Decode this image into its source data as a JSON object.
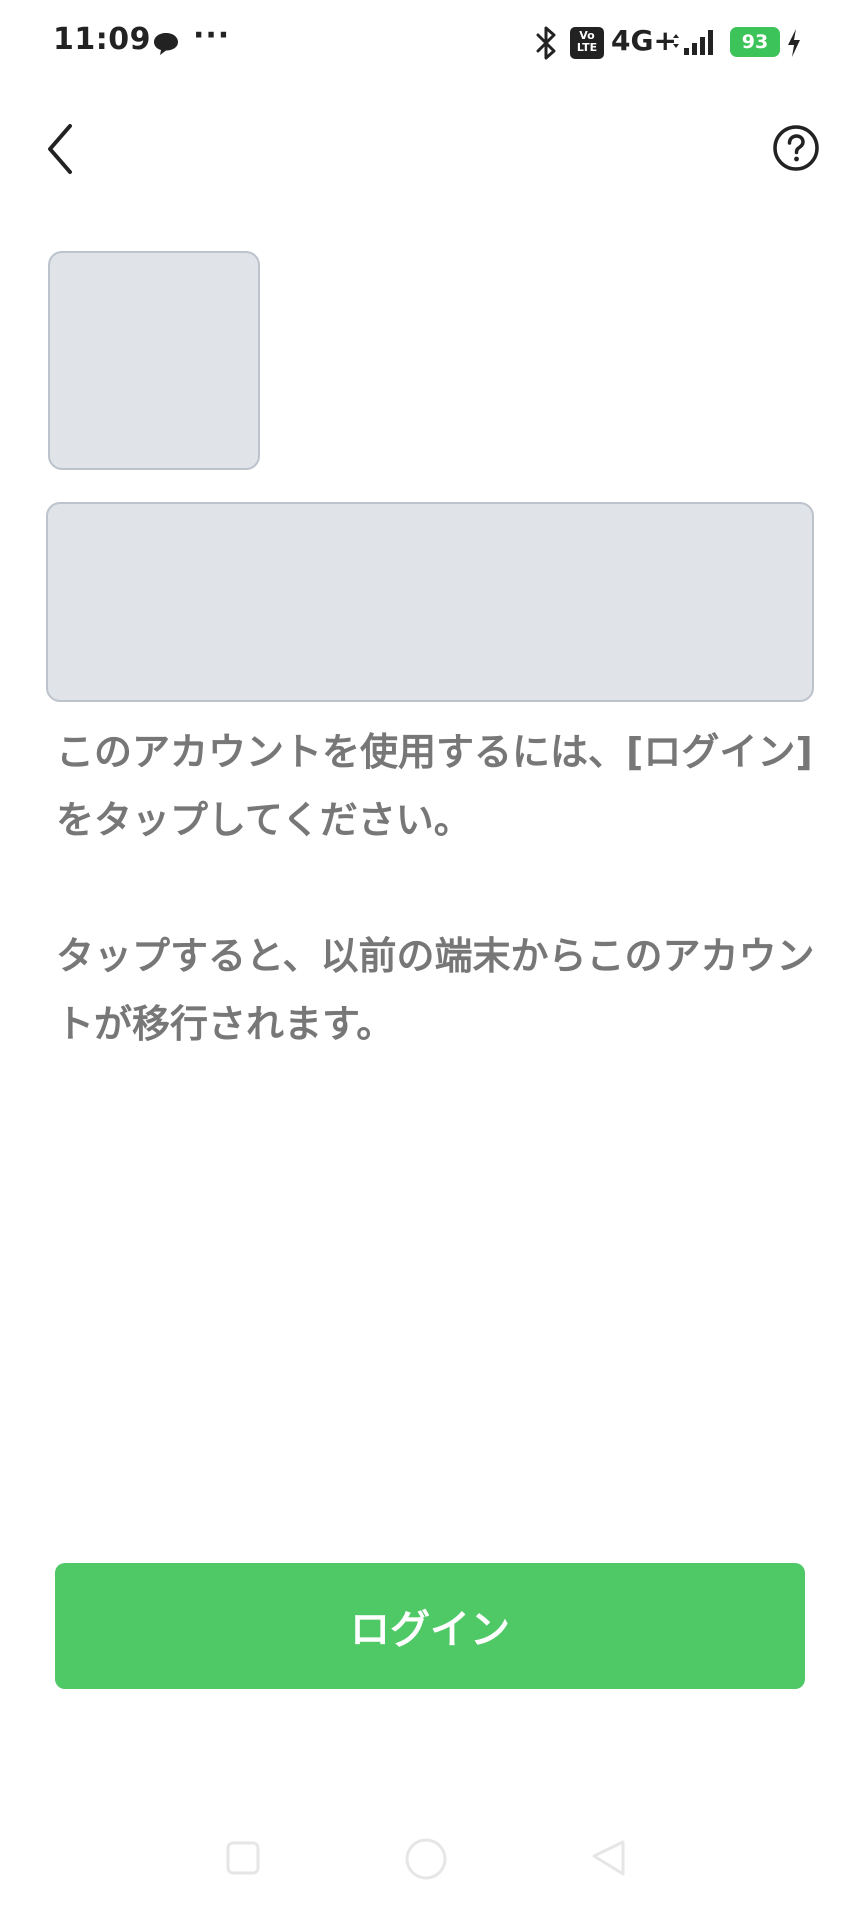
{
  "status_bar": {
    "time": "11:09",
    "more": "···",
    "volte_top": "Vo",
    "volte_bottom": "LTE",
    "network": "4G+",
    "battery": "93",
    "icons": [
      "chat-bubble-icon",
      "bluetooth-icon",
      "signal-icon",
      "charging-icon"
    ],
    "battery_color": "#3cc45a"
  },
  "header": {
    "back_icon": "chevron-left-icon",
    "help_icon": "question-circle-icon"
  },
  "message": {
    "line1": "このアカウントを使用するには、[ログイン]をタップしてください。",
    "line2": "タップすると、以前の端末からこのアカウントが移行されます。"
  },
  "login": {
    "label": "ログイン",
    "color": "#4fc866"
  },
  "nav_bar": {
    "icons": [
      "recent-apps-icon",
      "home-icon",
      "back-triangle-icon"
    ]
  }
}
